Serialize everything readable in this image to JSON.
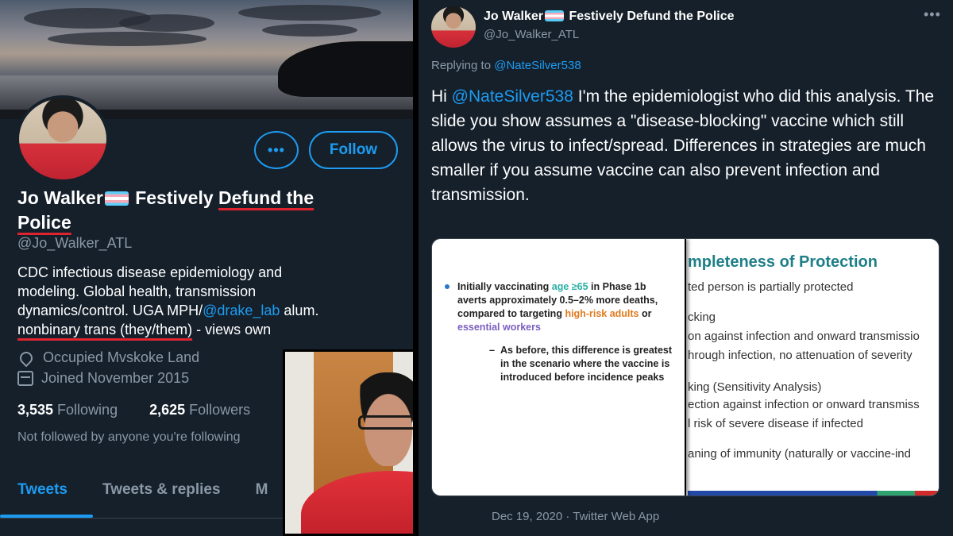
{
  "profile": {
    "name_part1": "Jo Walker",
    "name_part2": " Festively ",
    "name_underlined_1": "Defund the",
    "name_underlined_2": "Police",
    "handle": "@Jo_Walker_ATL",
    "bio_line1": "CDC infectious disease epidemiology and",
    "bio_line2": "modeling. Global health, transmission",
    "bio_line3_pre": "dynamics/control. UGA MPH/",
    "bio_link": "@drake_lab",
    "bio_line3_post": " alum.",
    "bio_underlined": "nonbinary trans (they/them)",
    "bio_line4_post": " - views own",
    "location": "Occupied Mvskoke Land",
    "joined": "Joined November 2015",
    "following_count": "3,535",
    "following_label": " Following",
    "followers_count": "2,625",
    "followers_label": " Followers",
    "not_followed": "Not followed by anyone you're following",
    "more_label": "•••",
    "follow_label": "Follow"
  },
  "tabs": [
    {
      "label": "Tweets"
    },
    {
      "label": "Tweets & replies"
    },
    {
      "label": "M"
    }
  ],
  "tweet": {
    "name_part1": "Jo Walker",
    "name_part2": " Festively Defund the Police",
    "handle": "@Jo_Walker_ATL",
    "more_label": "•••",
    "replying_prefix": "Replying to ",
    "replying_handle": "@NateSilver538",
    "text_prefix": "Hi ",
    "text_mention": "@NateSilver538",
    "text_body": " I'm the epidemiologist who did this analysis. The slide you show assumes a \"disease-blocking\" vaccine which still allows the virus to infect/spread. Differences in strategies are much smaller if you assume vaccine can also prevent infection and transmission.",
    "meta": "Dec 19, 2020 · Twitter Web App"
  },
  "slide": {
    "bullet_pre": "Initially vaccinating ",
    "bullet_age": "age ≥65",
    "bullet_mid": " in Phase 1b averts approximately 0.5–2% more deaths, compared to targeting ",
    "bullet_high": "high-risk adults",
    "bullet_or": " or ",
    "bullet_essential": "essential workers",
    "sub_dash": "–",
    "sub_text": "As before, this difference is greatest in the scenario where the vaccine is introduced before incidence peaks",
    "right_title": "mpleteness of Protection",
    "right_lines": [
      "ted person is partially protected",
      "cking",
      "on against infection and onward transmissio",
      "hrough infection, no attenuation of severity",
      "king  (Sensitivity Analysis)",
      "ection against infection or onward transmiss",
      "l risk of severe disease if infected",
      "aning of immunity (naturally or vaccine-ind"
    ]
  },
  "colors": {
    "background": "#15202b",
    "accent": "#1d9bf0",
    "muted": "#8b98a5",
    "underline_red": "#e0242f",
    "slide_title": "#1f7f88"
  },
  "icons": {
    "location": "location-pin-icon",
    "joined": "calendar-icon",
    "more": "more-options-icon"
  }
}
